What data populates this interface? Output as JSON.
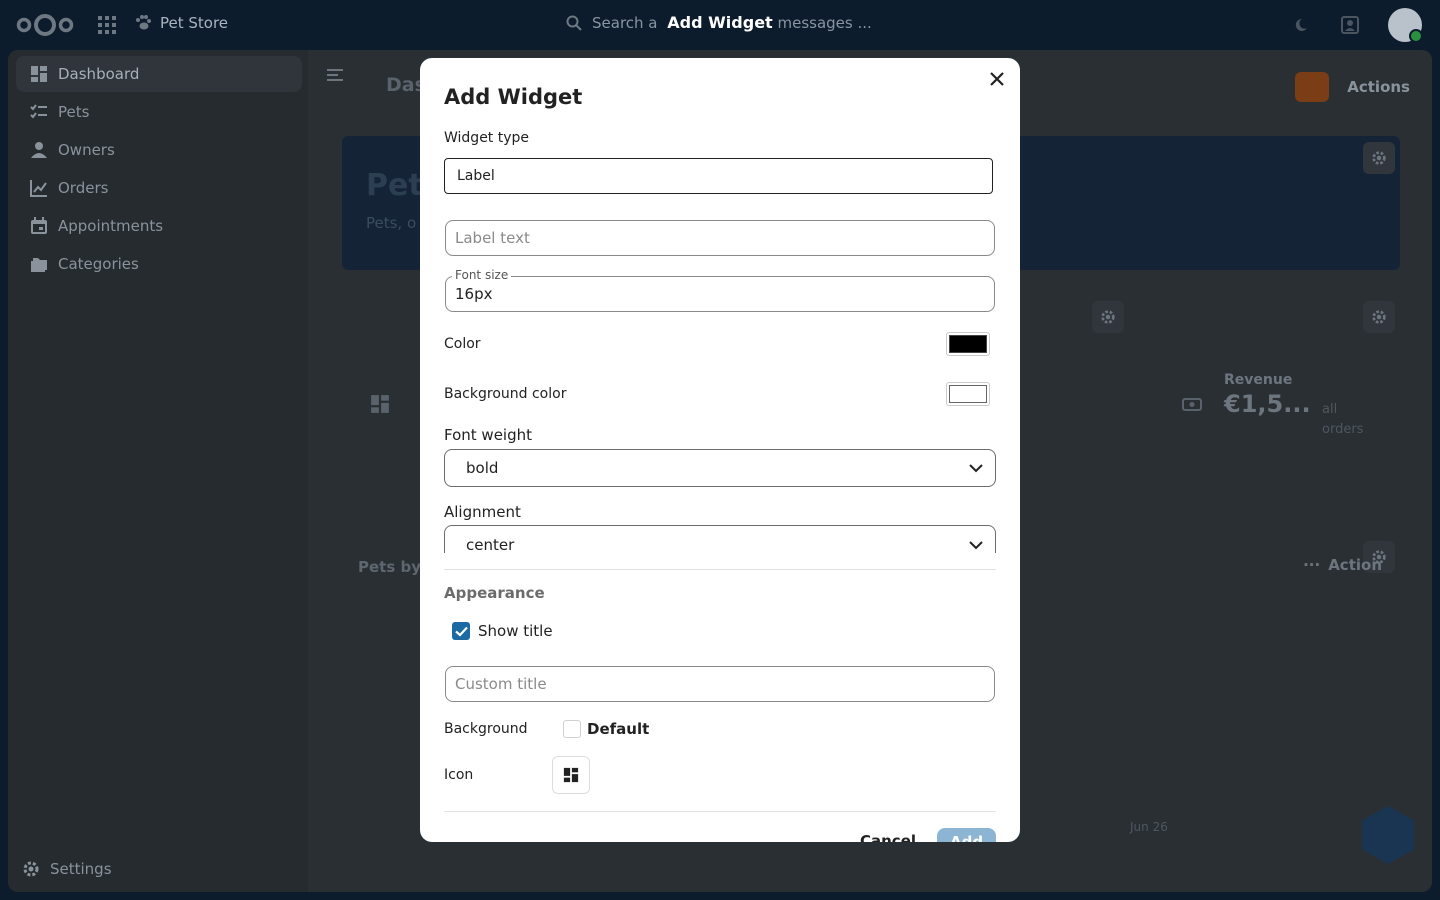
{
  "topbar": {
    "app_name": "Pet Store",
    "search_placeholder": "Search a",
    "search_suffix": "messages ...",
    "dialog_heading": "Add Widget"
  },
  "sidebar": {
    "items": [
      {
        "label": "Dashboard"
      },
      {
        "label": "Pets"
      },
      {
        "label": "Owners"
      },
      {
        "label": "Orders"
      },
      {
        "label": "Appointments"
      },
      {
        "label": "Categories"
      }
    ],
    "settings_label": "Settings"
  },
  "content": {
    "page_title": "Das",
    "actions_label": "Actions",
    "hero_title": "Pet",
    "hero_subtitle": "Pets, o",
    "revenue_label": "Revenue",
    "revenue_value": "€1,5...",
    "revenue_note_1": "all",
    "revenue_note_2": "orders",
    "pets_by": "Pets by",
    "actions_label_2": "Action",
    "date_label": "Jun 26"
  },
  "modal": {
    "title": "Add Widget",
    "widget_type_label": "Widget type",
    "widget_type_value": "Label",
    "label_text_placeholder": "Label text",
    "font_size_label": "Font size",
    "font_size_value": "16px",
    "color_label": "Color",
    "color_value": "#000000",
    "bg_color_label": "Background color",
    "bg_color_value": "#ffffff",
    "font_weight_label": "Font weight",
    "font_weight_value": "bold",
    "alignment_label": "Alignment",
    "alignment_value": "center",
    "appearance_title": "Appearance",
    "show_title_label": "Show title",
    "show_title_checked": true,
    "custom_title_placeholder": "Custom title",
    "background_label": "Background",
    "background_value": "Default",
    "icon_label": "Icon",
    "cancel_label": "Cancel",
    "add_label": "Add"
  },
  "colors": {
    "accent": "#1c6aa3",
    "add_button_disabled": "#8cb5d4",
    "overlay": "#0c1c2c"
  }
}
